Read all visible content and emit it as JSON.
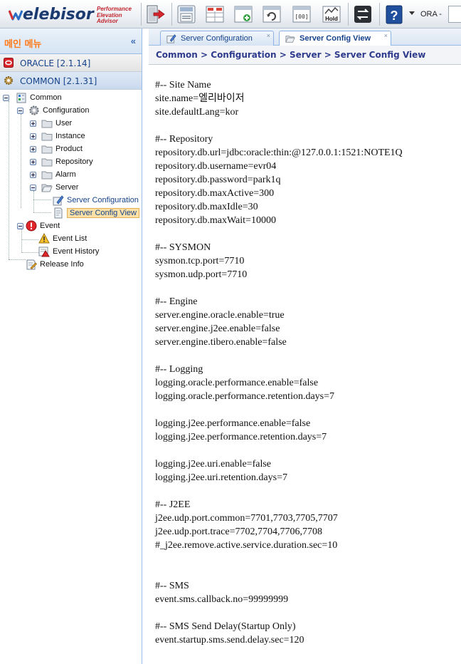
{
  "app": {
    "logo_word": "elebisor",
    "logo_tagline": [
      "Performance",
      "Elevation",
      "Advisor"
    ],
    "db_selector_label": "ORA -"
  },
  "toolbar": {
    "icons": [
      "logout-icon",
      "save-icon",
      "grid-config-icon",
      "add-screen-icon",
      "refresh-icon",
      "counter-icon",
      "hold-icon",
      "switch-icon",
      "help-icon"
    ],
    "hold_label": "Hold",
    "counter_label": "[00]"
  },
  "left_panel": {
    "title": "메인 메뉴",
    "collapse_label": "«",
    "accordion": [
      {
        "label": "ORACLE [2.1.14]",
        "icon": "oracle-icon",
        "active": false
      },
      {
        "label": "COMMON [2.1.31]",
        "icon": "gear-icon",
        "active": true
      }
    ],
    "tree": {
      "root": "Common",
      "configuration": "Configuration",
      "config_children": [
        "User",
        "Instance",
        "Product",
        "Repository",
        "Alarm",
        "Server"
      ],
      "server_children": [
        "Server Configuration",
        "Server Config View"
      ],
      "event": "Event",
      "event_children": [
        "Event List",
        "Event History"
      ],
      "release": "Release Info"
    }
  },
  "tabs": [
    {
      "label": "Server Configuration",
      "active": false,
      "close": "×"
    },
    {
      "label": "Server Config View",
      "active": true,
      "close": "×"
    }
  ],
  "breadcrumb": "Common > Configuration > Server > Server Config View",
  "config_lines": [
    "#-- Site Name",
    "site.name=엘리바이저",
    "site.defaultLang=kor",
    "",
    "#-- Repository",
    "repository.db.url=jdbc:oracle:thin:@127.0.0.1:1521:NOTE1Q",
    "repository.db.username=evr04",
    "repository.db.password=park1q",
    "repository.db.maxActive=300",
    "repository.db.maxIdle=30",
    "repository.db.maxWait=10000",
    "",
    "#-- SYSMON",
    "sysmon.tcp.port=7710",
    "sysmon.udp.port=7710",
    "",
    "#-- Engine",
    "server.engine.oracle.enable=true",
    "server.engine.j2ee.enable=false",
    "server.engine.tibero.enable=false",
    "",
    "#-- Logging",
    "logging.oracle.performance.enable=false",
    "logging.oracle.performance.retention.days=7",
    "",
    "logging.j2ee.performance.enable=false",
    "logging.j2ee.performance.retention.days=7",
    "",
    "logging.j2ee.uri.enable=false",
    "logging.j2ee.uri.retention.days=7",
    "",
    "#-- J2EE",
    "j2ee.udp.port.common=7701,7703,7705,7707",
    "j2ee.udp.port.trace=7702,7704,7706,7708",
    "#_j2ee.remove.active.service.duration.sec=10",
    "",
    "",
    "#-- SMS",
    "event.sms.callback.no=99999999",
    "",
    "#-- SMS Send Delay(Startup Only)",
    "event.startup.sms.send.delay.sec=120"
  ],
  "colors": {
    "accent_orange": "#ff7a1a",
    "link_blue": "#15428b",
    "breadcrumb": "#2f3b8c",
    "selection_bg": "#fbe1a6"
  }
}
